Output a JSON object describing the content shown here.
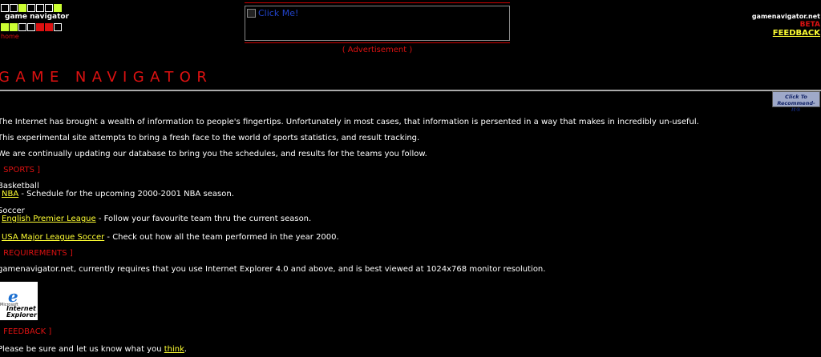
{
  "header": {
    "logo_text": "game navigator",
    "home_link": "home",
    "logo_rows": [
      [
        "w",
        "w",
        "y",
        "w",
        "w",
        "w",
        "y"
      ],
      [
        "y",
        "y",
        "w",
        "w",
        "r",
        "r",
        "w"
      ]
    ],
    "ad_image_alt": "Click Me!",
    "ad_caption": "( Advertisement )",
    "site_name": "gamenavigator.net",
    "beta_label": "BETA",
    "feedback_label": "FEEDBACK"
  },
  "title": "GAME NAVIGATOR",
  "recommend_button": {
    "line1": "Click To",
    "line2": "Recommend-It®"
  },
  "intro": [
    "The Internet has brought a wealth of information to people's fingertips. Unfortunately in most cases, that information is persented in a way that makes in incredibly un-useful.",
    "This experimental site attempts to bring a fresh face to the world of sports statistics, and result tracking.",
    "We are continually updating our database to bring you the schedules, and results for the teams you follow."
  ],
  "sports": {
    "heading": "[ SPORTS ]",
    "basketball_label": "Basketball",
    "nba_link": "NBA",
    "nba_desc": " - Schedule for the upcoming 2000-2001 NBA season.",
    "soccer_label": "Soccer",
    "epl_link": "English Premier League",
    "epl_desc": " - Follow your favourite team thru the current season.",
    "mls_link": "USA Major League Soccer",
    "mls_desc": " - Check out how all the team performed in the year 2000."
  },
  "requirements": {
    "heading": "[ REQUIREMENTS ]",
    "text": "gamenavigator.net, currently requires that you use Internet Explorer 4.0 and above, and is best viewed at 1024x768 monitor resolution.",
    "ie_logo_small": "Microsoft",
    "ie_logo_name1": "Internet",
    "ie_logo_name2": "Explorer"
  },
  "feedback": {
    "heading": "[ FEEDBACK ]",
    "text_before": "Please be sure and let us know what you ",
    "link": "think",
    "text_after": "."
  },
  "colors": {
    "background": "#000000",
    "accent_red": "#dd1111",
    "link_yellow": "#ffff33",
    "logo_green": "#ccff33"
  }
}
